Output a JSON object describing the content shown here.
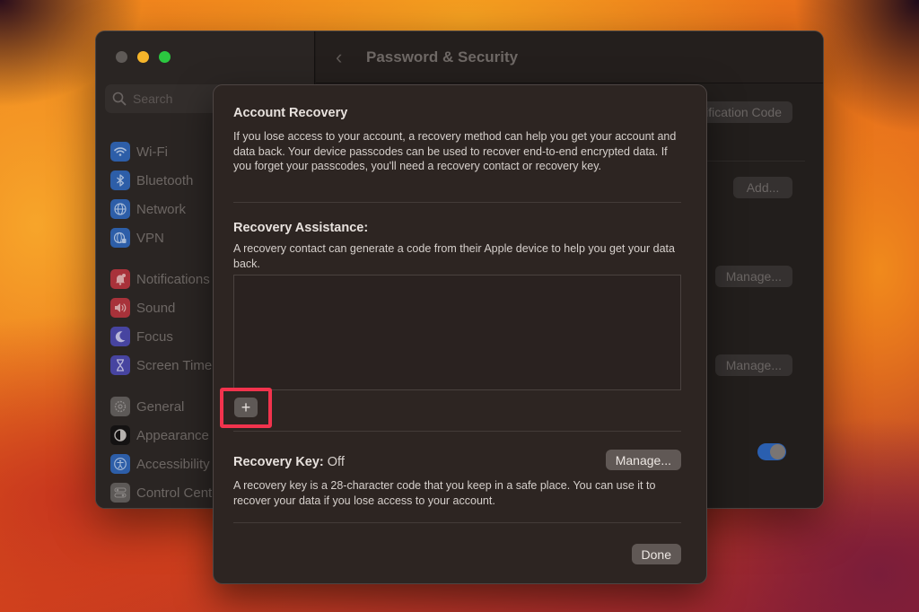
{
  "window": {
    "title": "Password & Security",
    "traffic_lights": {
      "close": "#5f5a57",
      "minimize": "#f6b52a",
      "maximize": "#2bc840"
    }
  },
  "sidebar": {
    "search_placeholder": "Search",
    "items": [
      {
        "label": "Wi-Fi",
        "icon": "wifi-icon",
        "color": "#2d63b8"
      },
      {
        "label": "Bluetooth",
        "icon": "bluetooth-icon",
        "color": "#2d63b8"
      },
      {
        "label": "Network",
        "icon": "globe-icon",
        "color": "#2d63b8"
      },
      {
        "label": "VPN",
        "icon": "vpn-globe-icon",
        "color": "#2d63b8"
      },
      {
        "label": "Notifications",
        "icon": "bell-icon",
        "color": "#b8333b"
      },
      {
        "label": "Sound",
        "icon": "speaker-icon",
        "color": "#b8333b"
      },
      {
        "label": "Focus",
        "icon": "moon-icon",
        "color": "#4b47a8"
      },
      {
        "label": "Screen Time",
        "icon": "hourglass-icon",
        "color": "#4b47a8"
      },
      {
        "label": "General",
        "icon": "gear-icon",
        "color": "#6a6664"
      },
      {
        "label": "Appearance",
        "icon": "appearance-icon",
        "color": "#111111"
      },
      {
        "label": "Accessibility",
        "icon": "accessibility-icon",
        "color": "#2d63b8"
      },
      {
        "label": "Control Centre",
        "icon": "control-centre-icon",
        "color": "#6a6664"
      }
    ]
  },
  "content": {
    "header_title": "Password & Security",
    "buttons": {
      "verification_code": "Get Verification Code",
      "add": "Add...",
      "manage_1": "Manage...",
      "manage_2": "Manage..."
    },
    "toggle_on": true
  },
  "sheet": {
    "account_recovery_title": "Account Recovery",
    "account_recovery_text": "If you lose access to your account, a recovery method can help you get your account and data back. Your device passcodes can be used to recover end-to-end encrypted data. If you forget your passcodes, you'll need a recovery contact or recovery key.",
    "recovery_assistance_title": "Recovery Assistance:",
    "recovery_assistance_text": "A recovery contact can generate a code from their Apple device to help you get your data back.",
    "recovery_contacts": [],
    "add_button": "+",
    "highlight_color": "#f2334d",
    "recovery_key_label": "Recovery Key:",
    "recovery_key_value": "Off",
    "recovery_key_manage": "Manage...",
    "recovery_key_text": "A recovery key is a 28-character code that you keep in a safe place. You can use it to recover your data if you lose access to your account.",
    "done_button": "Done"
  }
}
